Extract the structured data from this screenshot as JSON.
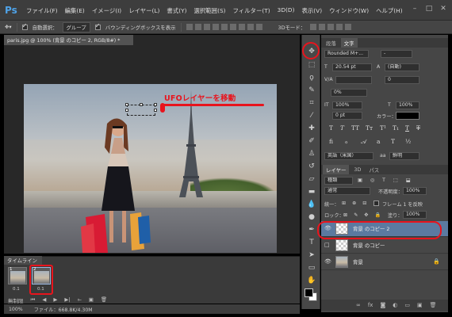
{
  "app": {
    "logo": "Ps"
  },
  "menu": [
    "ファイル(F)",
    "編集(E)",
    "イメージ(I)",
    "レイヤー(L)",
    "書式(Y)",
    "選択範囲(S)",
    "フィルター(T)",
    "3D(D)",
    "表示(V)",
    "ウィンドウ(W)",
    "ヘルプ(H)"
  ],
  "options": {
    "auto_select": "自動選択：",
    "auto_select_value": "グループ",
    "bounding_box": "バウンディングボックスを表示",
    "mode_3d": "3Dモード："
  },
  "document": {
    "tab_title": "paris.jpg @ 100% (背景 のコピー 2, RGB/8#) *",
    "annotation": "UFOレイヤーを移動"
  },
  "timeline": {
    "tab": "タイムライン",
    "frames": [
      {
        "num": "1",
        "duration": "0.1"
      },
      {
        "num": "2",
        "duration": "0.1"
      }
    ],
    "loop": "無制限"
  },
  "status": {
    "zoom": "100%",
    "file_info": "ファイル：668.8K/4.30M"
  },
  "char_panel": {
    "tabs": [
      "段落",
      "文字"
    ],
    "font": "Rounded M+...",
    "font_style": "-",
    "size": "20.54 pt",
    "leading": "(自動)",
    "kerning": "V/A",
    "tracking": "0",
    "vscale": "0%",
    "hscale_label": "100%",
    "vscale_label": "100%",
    "baseline": "0 pt",
    "color_label": "カラー：",
    "language": "英語（米国）",
    "aa": "鮮明"
  },
  "layers_panel": {
    "tabs": [
      "レイヤー",
      "3D",
      "パス"
    ],
    "kind": "種類",
    "blend": "通常",
    "opacity_label": "不透明度：",
    "opacity": "100%",
    "unify_label": "統一：",
    "propagate": "フレーム 1 を反映",
    "lock_label": "ロック：",
    "fill_label": "塗り：",
    "fill": "100%",
    "layers": [
      {
        "name": "背景 のコピー 2",
        "selected": true
      },
      {
        "name": "背景 のコピー",
        "selected": false
      },
      {
        "name": "背景",
        "selected": false
      }
    ]
  },
  "colors": {
    "annotation_red": "#e8141d",
    "selected_layer": "#5b7aa0"
  }
}
